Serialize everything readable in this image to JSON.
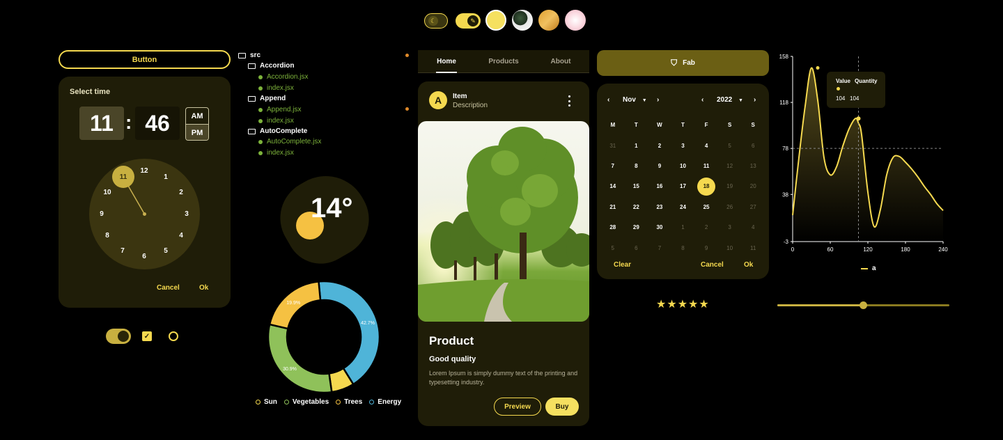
{
  "colors": {
    "accent": "#f5d94f",
    "card": "#1f1d08",
    "background": "#000000"
  },
  "top_bar": {
    "icons": [
      "moon-toggle-icon",
      "brush-toggle-icon",
      "yellow-theme-swatch",
      "leaf-theme-swatch",
      "orange-theme-swatch",
      "pink-theme-swatch"
    ]
  },
  "button": {
    "label": "Button"
  },
  "time_picker": {
    "title": "Select time",
    "hour": "11",
    "separator": ":",
    "minute": "46",
    "am": "AM",
    "pm": "PM",
    "clock_numbers": [
      "12",
      "1",
      "2",
      "3",
      "4",
      "5",
      "6",
      "7",
      "8",
      "9",
      "10",
      "11"
    ],
    "selected_hour": "11",
    "cancel": "Cancel",
    "ok": "Ok"
  },
  "tree": {
    "root": "src",
    "items": [
      {
        "folder": "Accordion",
        "files": [
          "Accordion.jsx",
          "index.jsx"
        ]
      },
      {
        "folder": "Append",
        "files": [
          "Append.jsx",
          "index.jsx"
        ]
      },
      {
        "folder": "AutoComplete",
        "files": [
          "AutoComplete.jsx",
          "index.jsx"
        ]
      }
    ]
  },
  "weather": {
    "temperature": "14°"
  },
  "chart_data": [
    {
      "type": "pie",
      "categories": [
        "Energy",
        "Sun",
        "Vegetables",
        "Trees"
      ],
      "values": [
        42.7,
        6.6,
        30.9,
        19.9
      ],
      "data_labels": [
        "42.7%",
        "",
        "30.9%",
        "19.9%"
      ],
      "legend": [
        "Sun",
        "Vegetables",
        "Trees",
        "Energy"
      ],
      "legend_colors": [
        "#f5d94f",
        "#8fc15a",
        "#f5c142",
        "#4fb4d8"
      ],
      "legend_placement": "bottom",
      "title": ""
    },
    {
      "type": "line",
      "x": [
        0,
        10,
        20,
        30,
        40,
        50,
        60,
        70,
        80,
        90,
        100,
        105,
        110,
        120,
        130,
        140,
        150,
        160,
        170,
        180,
        190,
        200,
        210,
        220,
        230,
        240
      ],
      "series": [
        {
          "name": "a",
          "values": [
            20,
            70,
            115,
            148,
            120,
            70,
            55,
            62,
            80,
            95,
            104,
            100,
            90,
            40,
            10,
            25,
            55,
            70,
            71,
            66,
            60,
            53,
            45,
            38,
            30,
            24
          ]
        }
      ],
      "xticks": [
        "0",
        "60",
        "120",
        "180",
        "240"
      ],
      "yticks": [
        "158",
        "118",
        "78",
        "38",
        "-3"
      ],
      "xlim": [
        0,
        240
      ],
      "ylim": [
        -3,
        158
      ],
      "tooltip": {
        "header_value": "Value",
        "header_quantity": "Quantity",
        "value": "104",
        "quantity": "104"
      },
      "legend_placement": "bottom"
    }
  ],
  "tabs": [
    {
      "label": "Home"
    },
    {
      "label": "Products"
    },
    {
      "label": "About"
    }
  ],
  "product_card": {
    "avatar_letter": "A",
    "item_title": "Item",
    "item_subtitle": "Description",
    "title": "Product",
    "subtitle": "Good quality",
    "description": "Lorem Ipsum is simply dummy text of the printing and typesetting industry.",
    "preview": "Preview",
    "buy": "Buy"
  },
  "fab": {
    "label": "Fab"
  },
  "calendar": {
    "month": "Nov",
    "year": "2022",
    "weekdays": [
      "M",
      "T",
      "W",
      "T",
      "F",
      "S",
      "S"
    ],
    "days": [
      [
        "31",
        "1",
        "2",
        "3",
        "4",
        "5",
        "6"
      ],
      [
        "7",
        "8",
        "9",
        "10",
        "11",
        "12",
        "13"
      ],
      [
        "14",
        "15",
        "16",
        "17",
        "18",
        "19",
        "20"
      ],
      [
        "21",
        "22",
        "23",
        "24",
        "25",
        "26",
        "27"
      ],
      [
        "28",
        "29",
        "30",
        "1",
        "2",
        "3",
        "4"
      ],
      [
        "5",
        "6",
        "7",
        "8",
        "9",
        "10",
        "11"
      ]
    ],
    "selected": "18",
    "clear": "Clear",
    "cancel": "Cancel",
    "ok": "Ok"
  },
  "rating": {
    "value": 5,
    "max": 5
  },
  "slider": {
    "value": 0.5
  }
}
